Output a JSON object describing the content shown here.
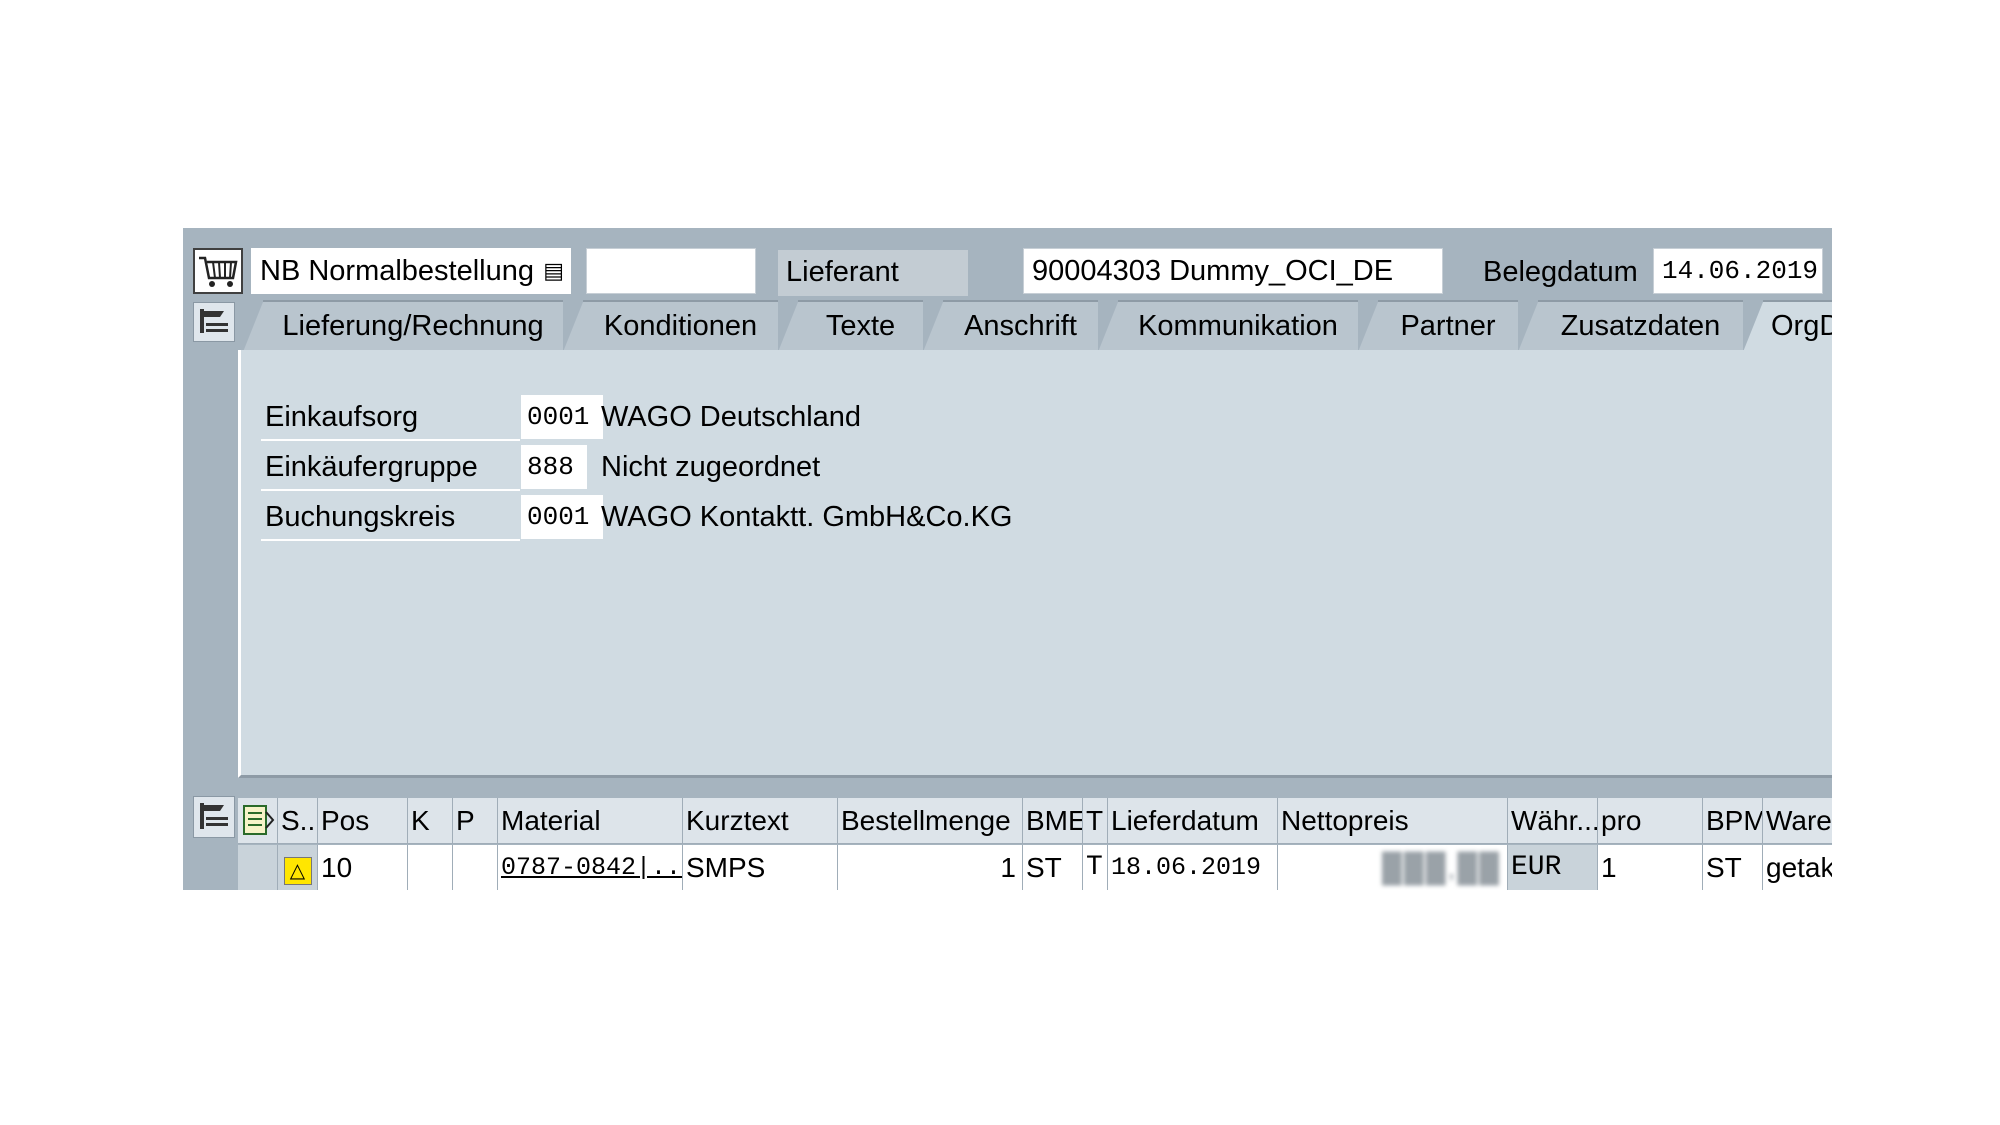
{
  "header": {
    "order_type": "NB Normalbestellung",
    "order_type_extra": "",
    "supplier_label": "Lieferant",
    "supplier_value": "90004303 Dummy_OCI_DE",
    "doc_date_label": "Belegdatum",
    "doc_date_value": "14.06.2019"
  },
  "tabs": [
    {
      "label": "Lieferung/Rechnung"
    },
    {
      "label": "Konditionen"
    },
    {
      "label": "Texte"
    },
    {
      "label": "Anschrift"
    },
    {
      "label": "Kommunikation"
    },
    {
      "label": "Partner"
    },
    {
      "label": "Zusatzdaten"
    },
    {
      "label": "OrgDa"
    }
  ],
  "org": [
    {
      "label": "Einkaufsorg",
      "code": "0001",
      "text": "WAGO Deutschland"
    },
    {
      "label": "Einkäufergruppe",
      "code": "888",
      "text": "Nicht zugeordnet"
    },
    {
      "label": "Buchungskreis",
      "code": "0001",
      "text": "WAGO Kontaktt. GmbH&Co.KG"
    }
  ],
  "table": {
    "headers": [
      "S...",
      "Pos",
      "K",
      "P",
      "Material",
      "Kurztext",
      "Bestellmenge",
      "BME",
      "T",
      "Lieferdatum",
      "Nettopreis",
      "Währ...",
      "pro",
      "BPM",
      "Waren"
    ],
    "row": {
      "status": "△",
      "pos": "10",
      "k": "",
      "p": "",
      "material": "0787-0842|...",
      "kurztext": "SMPS",
      "menge": "1",
      "bme": "ST",
      "t": "T",
      "lieferdatum": "18.06.2019",
      "nettopreis": "███,██",
      "waehrung": "EUR",
      "pro": "1",
      "bpm": "ST",
      "waren": "getakt"
    }
  }
}
